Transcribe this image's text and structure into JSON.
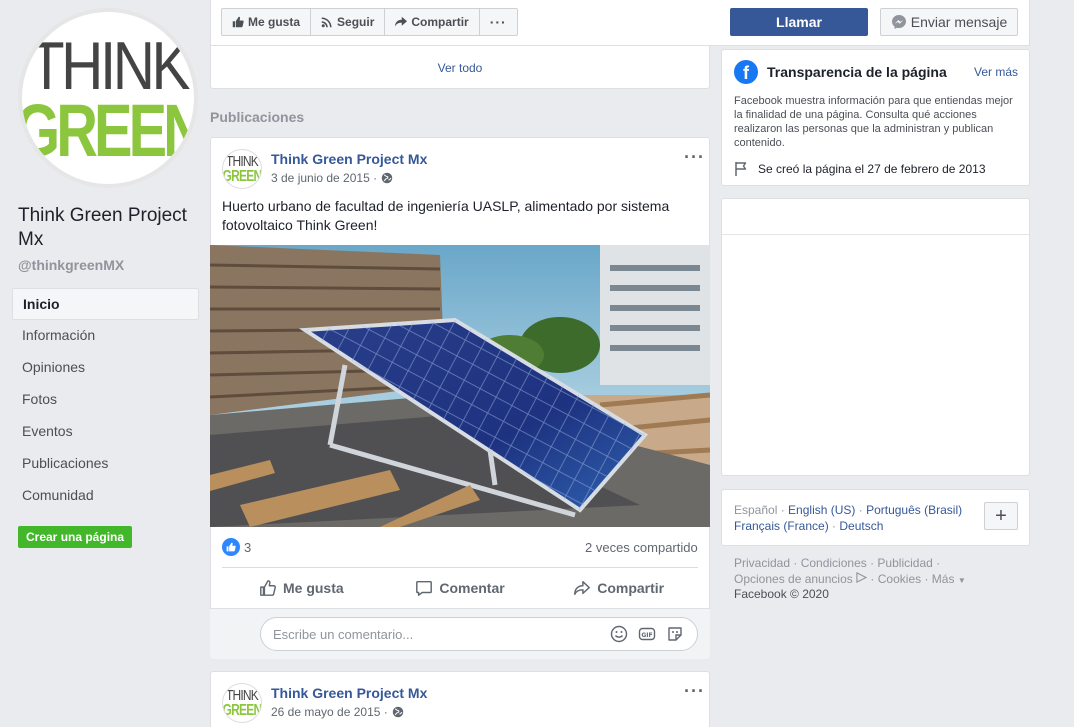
{
  "page": {
    "logo_top": "THINK",
    "logo_bottom": "GREEN",
    "name": "Think Green Project Mx",
    "handle": "@thinkgreenMX"
  },
  "nav": {
    "items": [
      {
        "label": "Inicio",
        "active": true
      },
      {
        "label": "Información"
      },
      {
        "label": "Opiniones"
      },
      {
        "label": "Fotos"
      },
      {
        "label": "Eventos"
      },
      {
        "label": "Publicaciones"
      },
      {
        "label": "Comunidad"
      }
    ],
    "create_page": "Crear una página"
  },
  "actions": {
    "like": "Me gusta",
    "follow": "Seguir",
    "share": "Compartir",
    "more": "···",
    "call": "Llamar",
    "message": "Enviar mensaje"
  },
  "feed": {
    "see_all": "Ver todo",
    "section_title": "Publicaciones"
  },
  "posts": [
    {
      "author": "Think Green Project Mx",
      "date": "3 de junio de 2015 ·",
      "text": "Huerto urbano de facultad de ingeniería UASLP, alimentado por sistema fotovoltaico Think Green!",
      "likes": "3",
      "shares": "2 veces compartido",
      "like_action": "Me gusta",
      "comment_action": "Comentar",
      "share_action": "Compartir",
      "comment_placeholder": "Escribe un comentario..."
    },
    {
      "author": "Think Green Project Mx",
      "date": "26 de mayo de 2015 ·"
    }
  ],
  "transparency": {
    "title": "Transparencia de la página",
    "see_more": "Ver más",
    "description": "Facebook muestra información para que entiendas mejor la finalidad de una página. Consulta qué acciones realizaron las personas que la administran y publican contenido.",
    "created": "Se creó la página el 27 de febrero de 2013"
  },
  "languages": {
    "current": "Español",
    "options": [
      "English (US)",
      "Português (Brasil)",
      "Français (France)",
      "Deutsch"
    ]
  },
  "footer": {
    "privacy": "Privacidad",
    "terms": "Condiciones",
    "ads": "Publicidad",
    "ad_choices": "Opciones de anuncios",
    "cookies": "Cookies",
    "more": "Más",
    "copyright": "Facebook © 2020"
  },
  "colors": {
    "facebook_blue": "#365899",
    "brand_blue": "#1877f2",
    "create_green": "#42b72a",
    "logo_green": "#8cc63f"
  }
}
